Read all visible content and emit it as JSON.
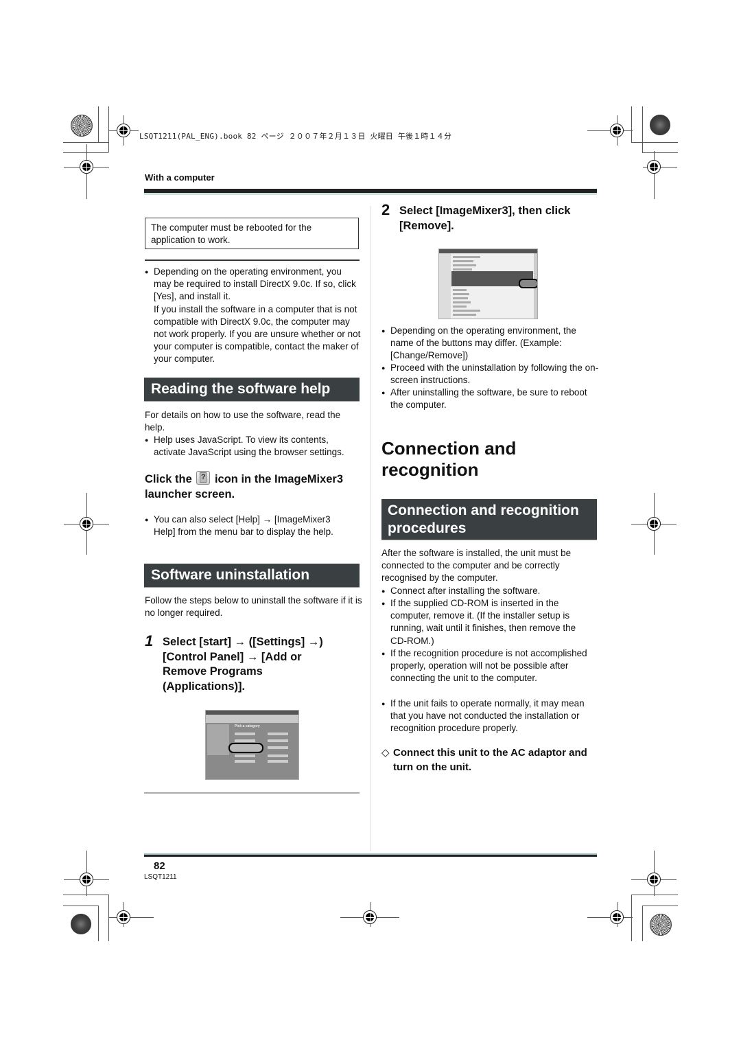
{
  "header": {
    "file_info": "LSQT1211(PAL_ENG).book  82 ページ  ２００７年２月１３日  火曜日  午後１時１４分",
    "section_label": "With a computer"
  },
  "left_column": {
    "note_box": "The computer must be rebooted for the application to work.",
    "directx_bullet": {
      "line1": "Depending on the operating environment, you may be required to install DirectX 9.0c. If so, click [Yes], and install it.",
      "line2": "If you install the software in a computer that is not compatible with DirectX 9.0c, the computer may not work properly. If you are unsure whether or not your computer is compatible, contact the maker of your computer."
    },
    "reading_help": {
      "banner": "Reading the software help",
      "intro": "For details on how to use the software, read the help.",
      "bullet_javascript": "Help uses JavaScript. To view its contents, activate JavaScript using the browser settings.",
      "instruction_pre": "Click the",
      "instruction_icon": "help-icon",
      "instruction_post": "icon in the ImageMixer3 launcher screen.",
      "bullet_menu": "You can also select [Help] → [ImageMixer3 Help] from the menu bar to display the help."
    },
    "uninstall": {
      "banner": "Software uninstallation",
      "intro": "Follow the steps below to uninstall the software if it is no longer required.",
      "step1_number": "1",
      "step1_text": "Select [start] → ([Settings] →) [Control Panel] → [Add or Remove Programs (Applications)].",
      "screenshot1_title": "Pick a category"
    }
  },
  "right_column": {
    "step2_number": "2",
    "step2_text": "Select [ImageMixer3], then click [Remove].",
    "step2_bullets": [
      "Depending on the operating environment, the name of the buttons may differ. (Example: [Change/Remove])",
      "Proceed with the uninstallation by following the on-screen instructions.",
      "After uninstalling the software, be sure to reboot the computer."
    ],
    "connection": {
      "title": "Connection and recognition",
      "banner": "Connection and recognition procedures",
      "intro": "After the software is installed, the unit must be connected to the computer and be correctly recognised by the computer.",
      "bullets": [
        "Connect after installing the software.",
        "If the supplied CD-ROM is inserted in the computer, remove it. (If the installer setup is running, wait until it finishes, then remove the CD-ROM.)",
        "If the recognition procedure is not accomplished properly, operation will not be possible after connecting the unit to the computer.",
        "If the unit fails to operate normally, it may mean that you have not conducted the installation or recognition procedure properly."
      ],
      "diamond_step_symbol": "◇",
      "diamond_step": "Connect this unit to the AC adaptor and turn on the unit."
    }
  },
  "footer": {
    "page_number": "82",
    "doc_code": "LSQT1211"
  }
}
